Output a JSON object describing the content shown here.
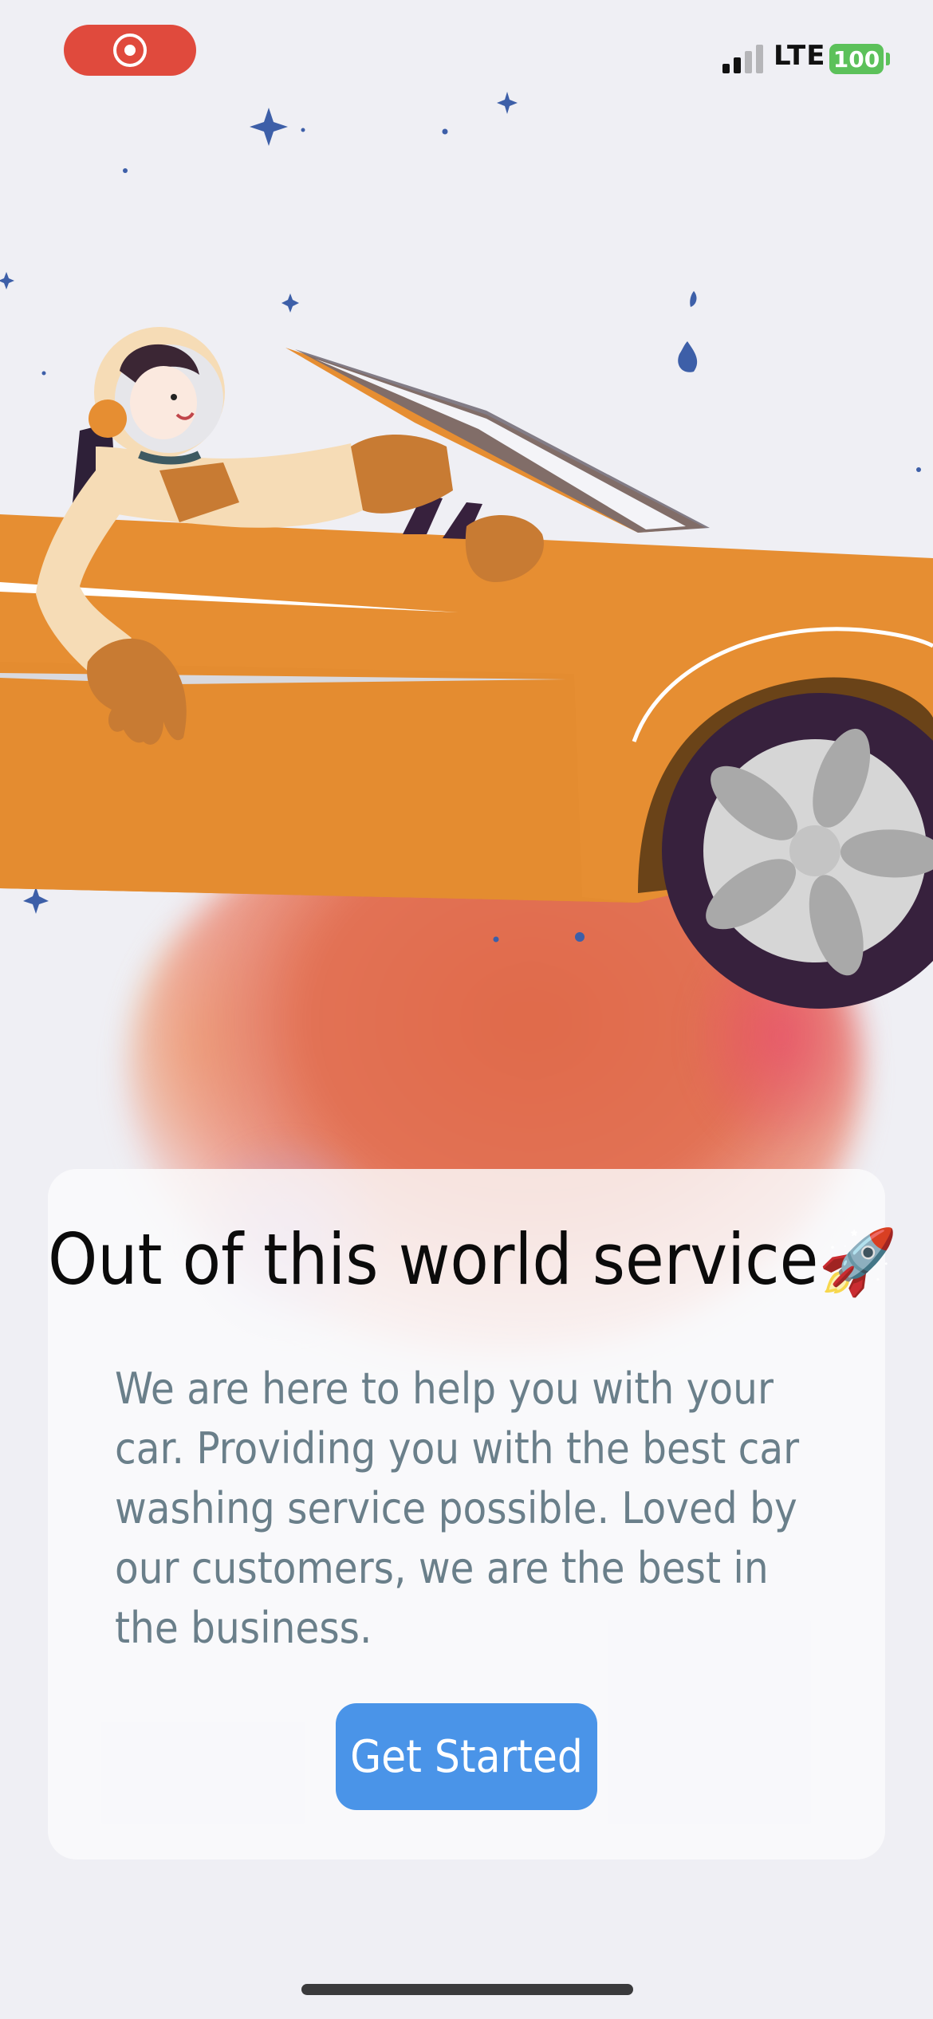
{
  "status_bar": {
    "recording_icon": "screen-recording-icon",
    "signal_icon": "cellular-signal-icon",
    "network": "LTE",
    "battery": "100"
  },
  "illustration": {
    "subject": "astronaut-driving-convertible-icon"
  },
  "card": {
    "title": "Out of this world service",
    "title_emoji": "🚀",
    "body": "We are here to help you with your car. Providing you with the best car washing service possible. Loved by our customers, we are the best in the business.",
    "cta_label": "Get Started"
  },
  "colors": {
    "accent": "#4a94e8",
    "car": "#e68e32",
    "record": "#e04a3d",
    "battery": "#5cc15a",
    "body_text": "#6a7f8a"
  }
}
